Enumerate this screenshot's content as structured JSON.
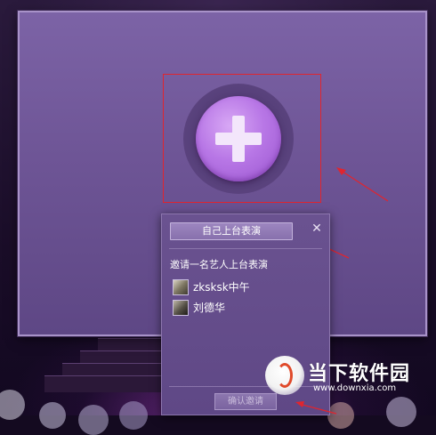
{
  "popup": {
    "perform_self_label": "自己上台表演",
    "close_symbol": "✕",
    "invite_label": "邀请一名艺人上台表演",
    "artists": [
      {
        "name": "zksksk中午"
      },
      {
        "name": "刘德华"
      }
    ],
    "confirm_label": "确认邀请"
  },
  "watermark": {
    "title": "当下软件园",
    "url": "www.downxia.com"
  },
  "colors": {
    "screen": "#6e5596",
    "popup": "#6a5290",
    "add_button": "#b877e6",
    "annotation_red": "#e0252f"
  },
  "icons": {
    "add": "plus-icon",
    "close": "close-icon"
  }
}
